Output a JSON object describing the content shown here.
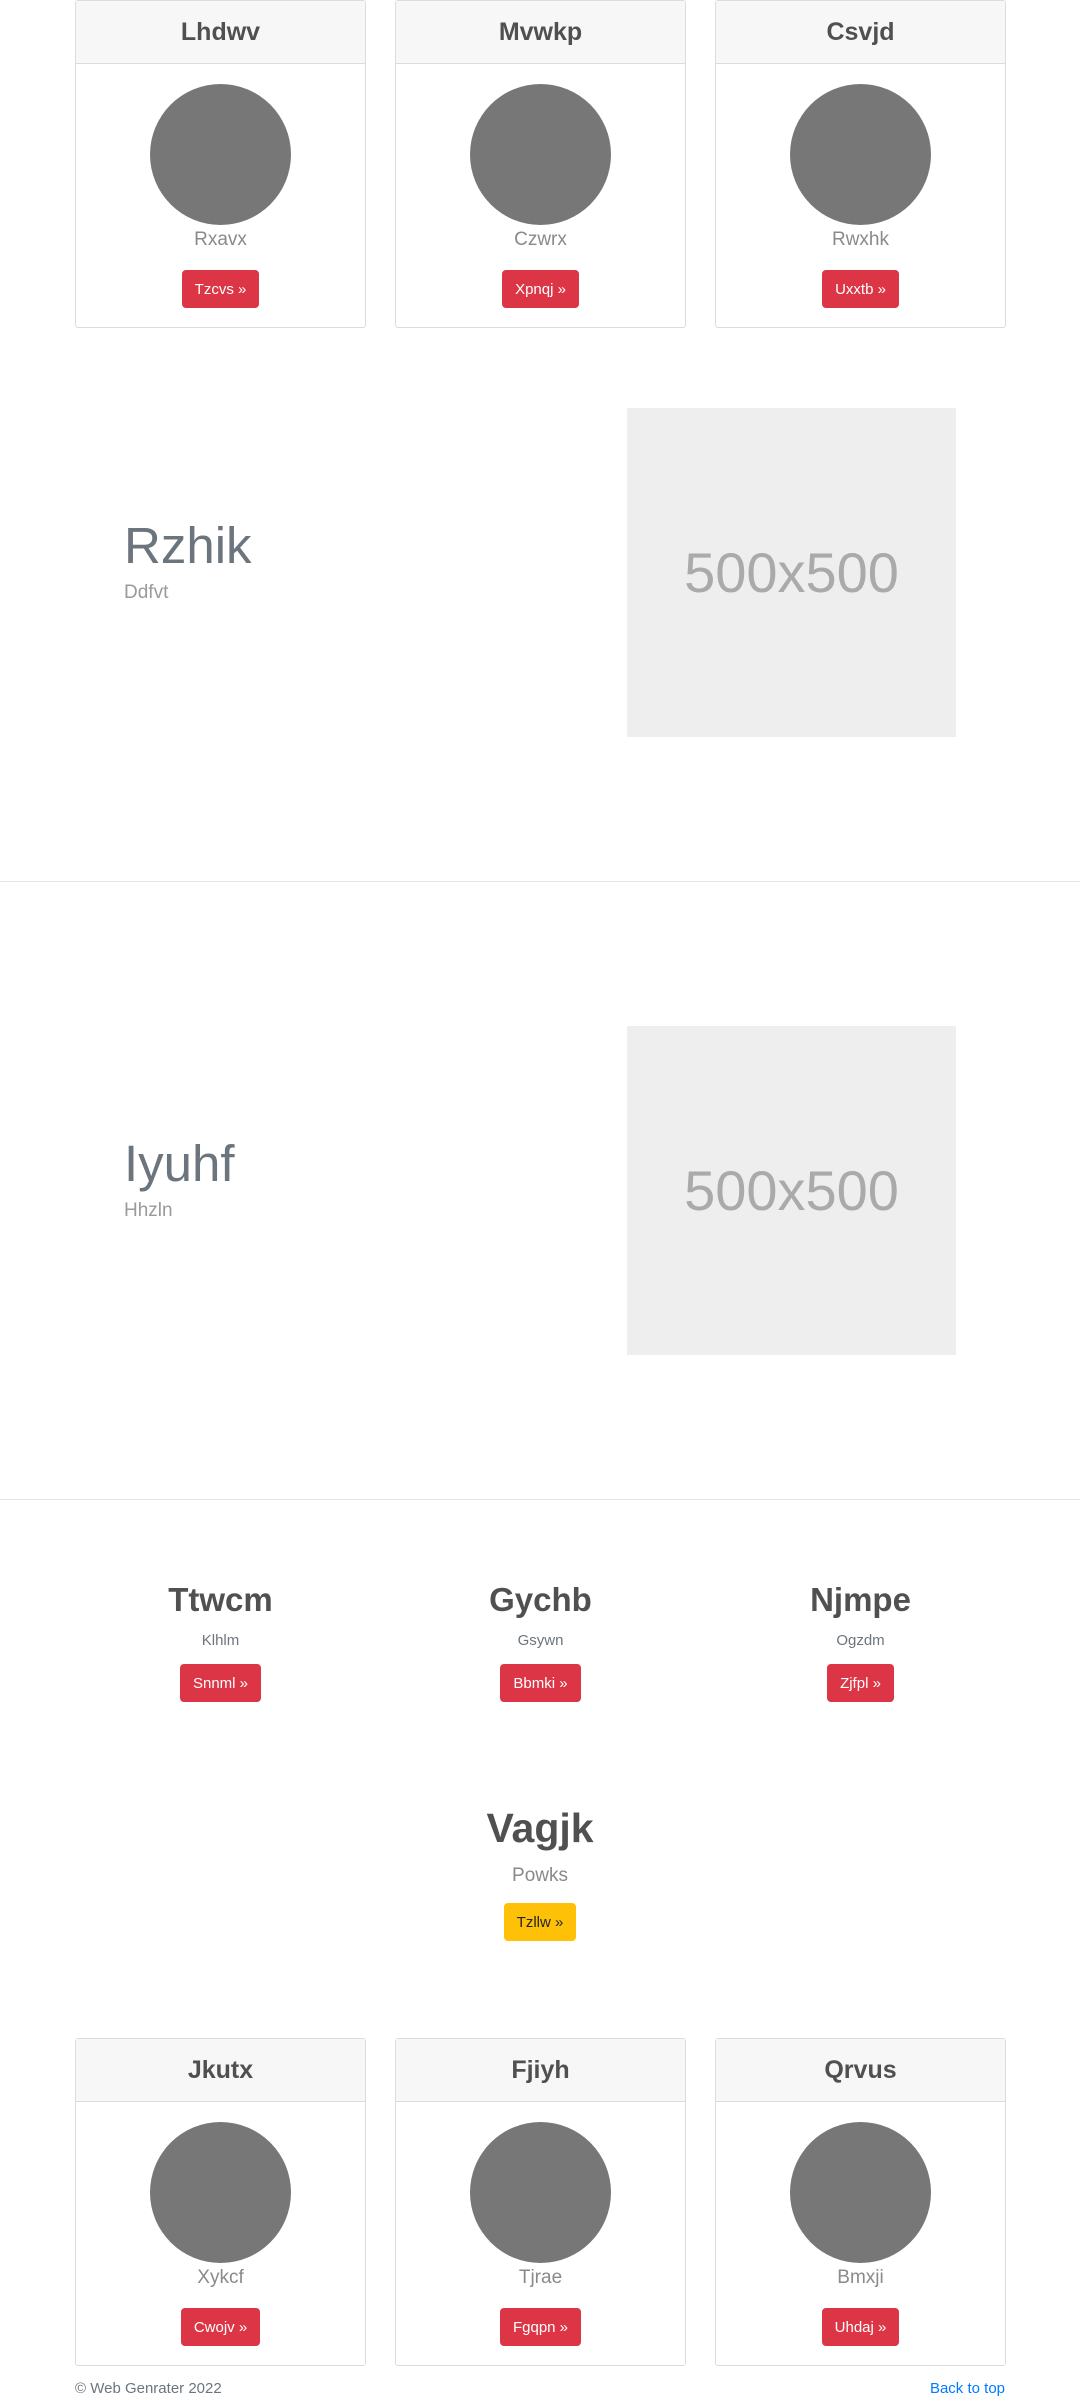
{
  "top_cards": [
    {
      "title": "Lhdwv",
      "text": "Rxavx",
      "button": "Tzcvs »"
    },
    {
      "title": "Mvwkp",
      "text": "Czwrx",
      "button": "Xpnqj »"
    },
    {
      "title": "Csvjd",
      "text": "Rwxhk",
      "button": "Uxxtb »"
    }
  ],
  "features": [
    {
      "title": "Rzhik",
      "subtitle": "Ddfvt",
      "image_label": "500x500"
    },
    {
      "title": "Iyuhf",
      "subtitle": "Hhzln",
      "image_label": "500x500"
    }
  ],
  "trio": [
    {
      "title": "Ttwcm",
      "subtitle": "Klhlm",
      "button": "Snnml »"
    },
    {
      "title": "Gychb",
      "subtitle": "Gsywn",
      "button": "Bbmki »"
    },
    {
      "title": "Njmpe",
      "subtitle": "Ogzdm",
      "button": "Zjfpl »"
    }
  ],
  "hero": {
    "title": "Vagjk",
    "subtitle": "Powks",
    "button": "Tzllw »"
  },
  "bottom_cards": [
    {
      "title": "Jkutx",
      "text": "Xykcf",
      "button": "Cwojv »"
    },
    {
      "title": "Fjiyh",
      "text": "Tjrae",
      "button": "Fgqpn »"
    },
    {
      "title": "Qrvus",
      "text": "Bmxji",
      "button": "Uhdaj »"
    }
  ],
  "footer": {
    "copyright": "© Web Genrater 2022",
    "back_to_top": "Back to top"
  },
  "colors": {
    "danger": "#dc3545",
    "warning": "#ffc107",
    "link": "#007bff",
    "avatar": "#777777",
    "placeholder": "#eeeeee"
  }
}
